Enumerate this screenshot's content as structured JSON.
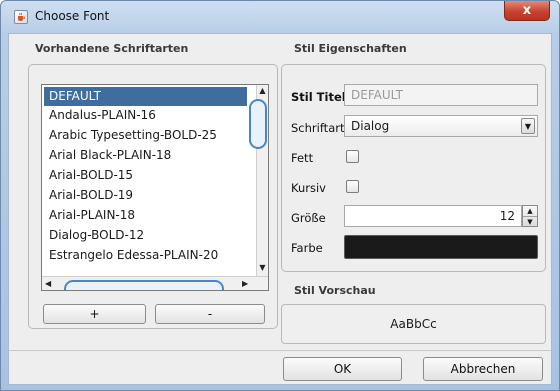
{
  "window": {
    "title": "Choose Font",
    "close_glyph": "x"
  },
  "fonts_panel": {
    "heading": "Vorhandene Schriftarten",
    "items": [
      "DEFAULT",
      "Andalus-PLAIN-16",
      "Arabic Typesetting-BOLD-25",
      "Arial Black-PLAIN-18",
      "Arial-BOLD-15",
      "Arial-BOLD-19",
      "Arial-PLAIN-18",
      "Dialog-BOLD-12",
      "Estrangelo Edessa-PLAIN-20"
    ],
    "selected_index": 0,
    "add_label": "+",
    "remove_label": "-"
  },
  "properties_panel": {
    "heading": "Stil Eigenschaften",
    "title_label": "Stil Titel",
    "title_value": "DEFAULT",
    "font_label": "Schriftart",
    "font_value": "Dialog",
    "bold_label": "Fett",
    "bold_checked": false,
    "italic_label": "Kursiv",
    "italic_checked": false,
    "size_label": "Größe",
    "size_value": "12",
    "color_label": "Farbe",
    "color_value": "#1a1a1a"
  },
  "preview_panel": {
    "heading": "Stil Vorschau",
    "sample_text": "AaBbCc"
  },
  "footer": {
    "ok_label": "OK",
    "cancel_label": "Abbrechen"
  },
  "colors": {
    "selection": "#3f6e9e",
    "titlebar": "#b7cde7",
    "close_button": "#c7432f"
  },
  "icons": {
    "app": "java-coffee-cup-icon",
    "close": "close-icon",
    "scroll_up": "triangle-up-icon",
    "scroll_down": "triangle-down-icon",
    "scroll_left": "triangle-left-icon",
    "scroll_right": "triangle-right-icon",
    "dropdown": "chevron-down-icon",
    "spinner_up": "triangle-up-icon",
    "spinner_down": "triangle-down-icon"
  }
}
